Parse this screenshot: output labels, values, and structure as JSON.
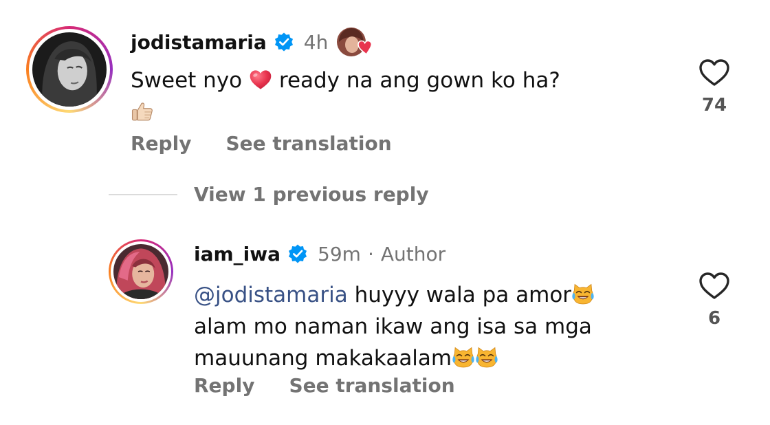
{
  "comments": [
    {
      "username": "jodistamaria",
      "time": "4h",
      "text_parts": [
        "Sweet nyo",
        "ready na ang gown ko ha?"
      ],
      "reply_label": "Reply",
      "translate_label": "See translation",
      "like_count": "74",
      "icons": [
        "verified-badge-icon",
        "red-heart-emoji",
        "thumbs-up-emoji",
        "heart-outline-icon"
      ]
    },
    {
      "username": "iam_iwa",
      "time": "59m",
      "separator": "·",
      "author_label": "Author",
      "mention": "@jodistamaria",
      "text_parts": [
        "huyyy wala pa amor",
        "alam mo naman ikaw ang isa sa mga",
        "mauunang makakaalam"
      ],
      "reply_label": "Reply",
      "translate_label": "See translation",
      "like_count": "6",
      "icons": [
        "verified-badge-icon",
        "cat-tears-of-joy-emoji",
        "heart-outline-icon"
      ]
    }
  ],
  "view_replies_label": "View 1 previous reply",
  "colors": {
    "text": "#111111",
    "muted": "#737373",
    "mention": "#385185",
    "verified": "#0095f6",
    "heart_emoji": "#e8344e"
  }
}
